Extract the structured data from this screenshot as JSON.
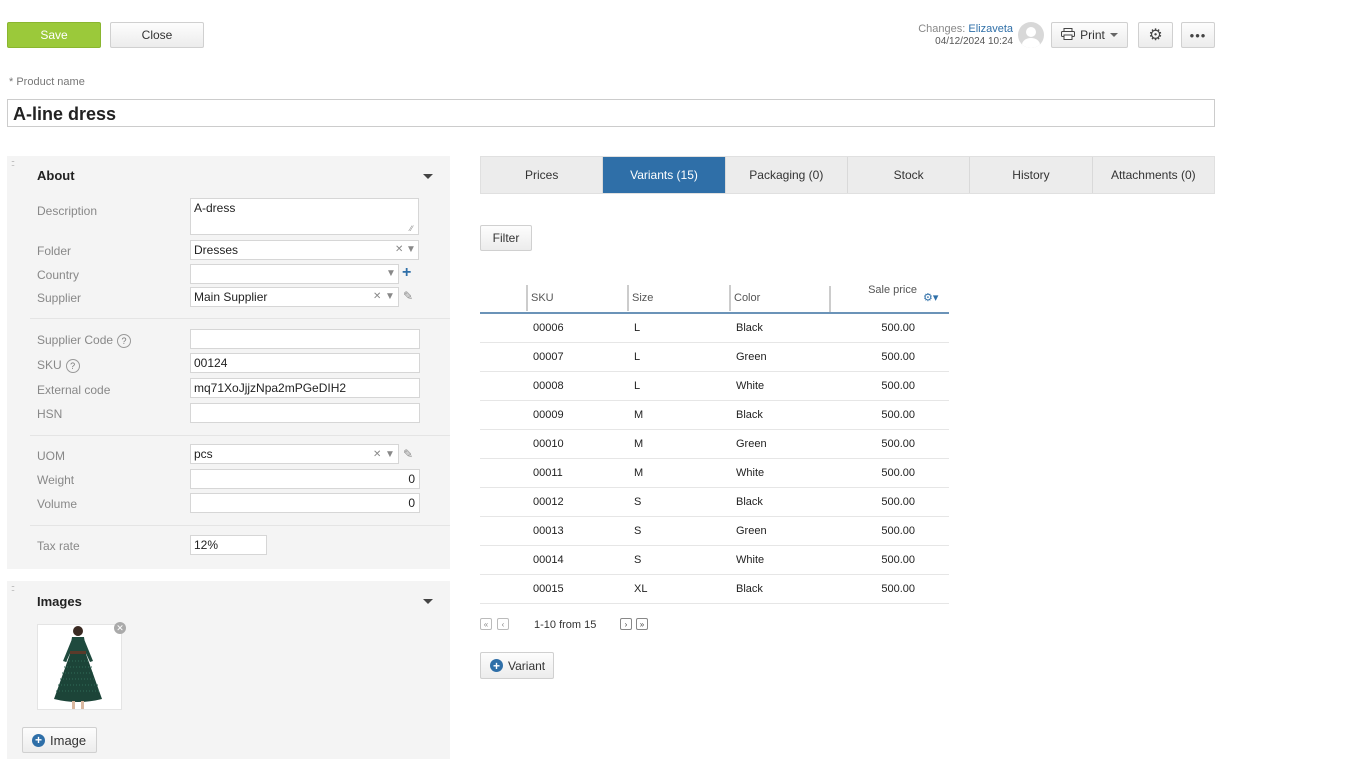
{
  "toolbar": {
    "save_label": "Save",
    "close_label": "Close",
    "changes_label": "Changes:",
    "changes_user": "Elizaveta",
    "changes_time": "04/12/2024 10:24",
    "print_label": "Print"
  },
  "product": {
    "name_label": "* Product name",
    "name_value": "A-line dress"
  },
  "about": {
    "title": "About",
    "description_label": "Description",
    "description_value": "A-dress",
    "folder_label": "Folder",
    "folder_value": "Dresses",
    "country_label": "Country",
    "country_value": "",
    "supplier_label": "Supplier",
    "supplier_value": "Main Supplier",
    "supplier_code_label": "Supplier Code",
    "supplier_code_value": "",
    "sku_label": "SKU",
    "sku_value": "00124",
    "external_code_label": "External code",
    "external_code_value": "mq71XoJjjzNpa2mPGeDIH2",
    "hsn_label": "HSN",
    "hsn_value": "",
    "uom_label": "UOM",
    "uom_value": "pcs",
    "weight_label": "Weight",
    "weight_value": "0",
    "volume_label": "Volume",
    "volume_value": "0",
    "tax_label": "Tax rate",
    "tax_value": "12%"
  },
  "images": {
    "title": "Images",
    "add_label": "Image"
  },
  "tabs": [
    "Prices",
    "Variants (15)",
    "Packaging (0)",
    "Stock",
    "History",
    "Attachments (0)"
  ],
  "active_tab": 1,
  "variants": {
    "filter_label": "Filter",
    "columns": [
      "SKU",
      "Size",
      "Color",
      "Sale price"
    ],
    "rows": [
      [
        "00006",
        "L",
        "Black",
        "500.00"
      ],
      [
        "00007",
        "L",
        "Green",
        "500.00"
      ],
      [
        "00008",
        "L",
        "White",
        "500.00"
      ],
      [
        "00009",
        "M",
        "Black",
        "500.00"
      ],
      [
        "00010",
        "M",
        "Green",
        "500.00"
      ],
      [
        "00011",
        "M",
        "White",
        "500.00"
      ],
      [
        "00012",
        "S",
        "Black",
        "500.00"
      ],
      [
        "00013",
        "S",
        "Green",
        "500.00"
      ],
      [
        "00014",
        "S",
        "White",
        "500.00"
      ],
      [
        "00015",
        "XL",
        "Black",
        "500.00"
      ]
    ],
    "pager_text": "1-10 from 15",
    "add_variant_label": "Variant"
  },
  "colors": {
    "accent": "#2f6fa8",
    "save": "#9bc93a"
  }
}
